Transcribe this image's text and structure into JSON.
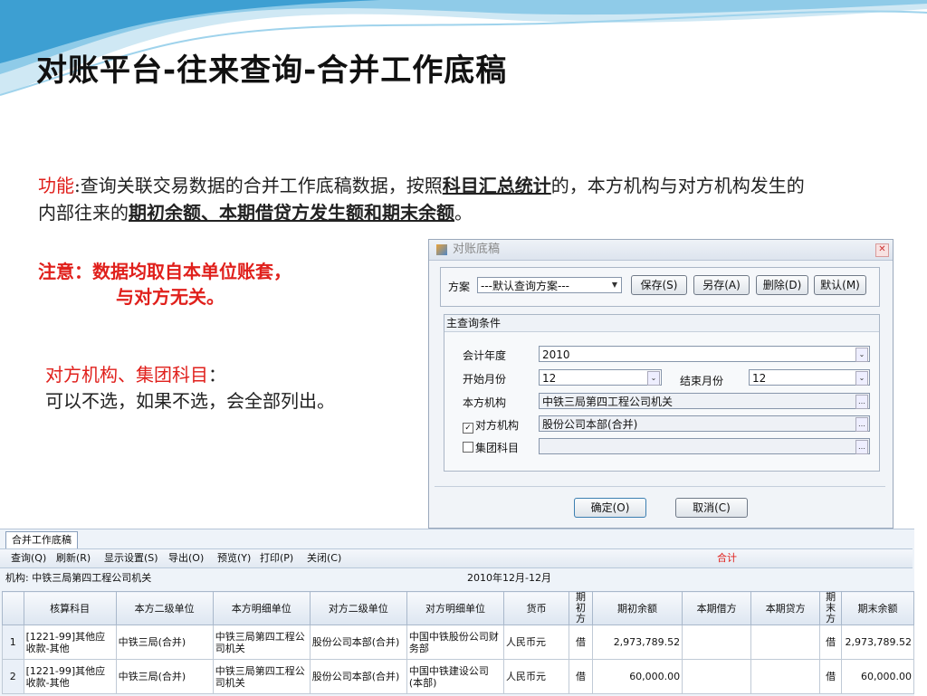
{
  "slide": {
    "title": "对账平台-往来查询-合并工作底稿",
    "desc_label": "功能",
    "desc_p1": ":查询关联交易数据的合并工作底稿数据，按照",
    "desc_b1": "科目汇总统计",
    "desc_p2": "的，本方机构与对方机构发生的内部往来的",
    "desc_b2": "期初余额、本期借贷方发生额和期末余额",
    "desc_p3": "。",
    "note_line1": "注意：数据均取自本单位账套，",
    "note_line2": "与对方无关。",
    "note2_label": "对方机构、集团科目",
    "note2_colon": "：",
    "note2_text": "可以不选，如果不选，会全部列出。"
  },
  "dialog": {
    "title": "对账底稿",
    "scheme_label": "方案",
    "scheme_value": "---默认查询方案---",
    "btn_save": "保存(S)",
    "btn_saveas": "另存(A)",
    "btn_delete": "删除(D)",
    "btn_default": "默认(M)",
    "group_title": "主查询条件",
    "year_label": "会计年度",
    "year_value": "2010",
    "start_label": "开始月份",
    "start_value": "12",
    "end_label": "结束月份",
    "end_value": "12",
    "org_label": "本方机构",
    "org_value": "中铁三局第四工程公司机关",
    "counter_label": "对方机构",
    "counter_value": "股份公司本部(合并)",
    "group_subject_label": "集团科目",
    "group_subject_value": "",
    "btn_ok": "确定(O)",
    "btn_cancel": "取消(C)"
  },
  "grid_window": {
    "tab": "合并工作底稿",
    "toolbar": [
      "查询(Q)",
      "刷新(R)",
      "显示设置(S)",
      "导出(O)",
      "预览(Y)",
      "打印(P)",
      "关闭(C)"
    ],
    "sum_label": "合计",
    "org_info": "机构:  中铁三局第四工程公司机关",
    "period": "2010年12月-12月",
    "headers": [
      "核算科目",
      "本方二级单位",
      "本方明细单位",
      "对方二级单位",
      "对方明细单位",
      "货币",
      "期初方",
      "期初余额",
      "本期借方",
      "本期贷方",
      "期末方",
      "期末余额"
    ],
    "rows": [
      {
        "n": "1",
        "subject": "[1221-99]其他应收款-其他",
        "own2": "中铁三局(合并)",
        "own_detail": "中铁三局第四工程公司机关",
        "cp2": "股份公司本部(合并)",
        "cp_detail": "中国中铁股份公司财务部",
        "currency": "人民币元",
        "open_dir": "借",
        "open_bal": "2,973,789.52",
        "debit": "",
        "credit": "",
        "close_dir": "借",
        "close_bal": "2,973,789.52"
      },
      {
        "n": "2",
        "subject": "[1221-99]其他应收款-其他",
        "own2": "中铁三局(合并)",
        "own_detail": "中铁三局第四工程公司机关",
        "cp2": "股份公司本部(合并)",
        "cp_detail": "中国中铁建设公司(本部)",
        "currency": "人民币元",
        "open_dir": "借",
        "open_bal": "60,000.00",
        "debit": "",
        "credit": "",
        "close_dir": "借",
        "close_bal": "60,000.00"
      }
    ]
  },
  "colors": {
    "accent_red": "#e0201c",
    "wave_blue": "#4aa6d6"
  }
}
